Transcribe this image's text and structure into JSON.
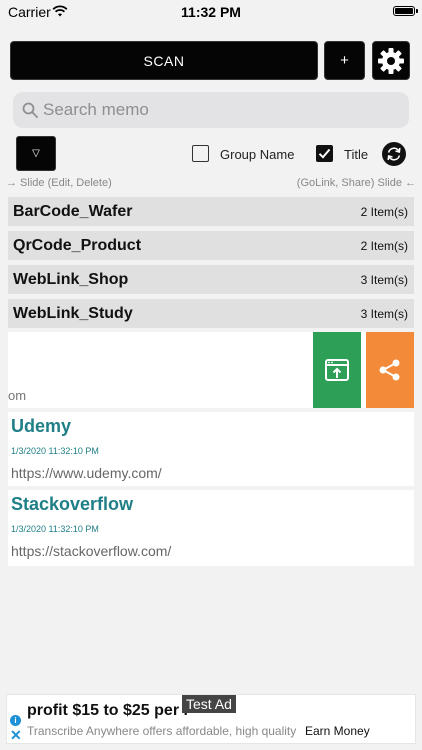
{
  "status_bar": {
    "carrier": "Carrier",
    "time": "11:32 PM"
  },
  "toolbar": {
    "scan_label": "SCAN",
    "add_label": "+"
  },
  "search": {
    "placeholder": "Search memo"
  },
  "filters": {
    "dropdown_label": "▽",
    "group_name_label": "Group Name",
    "group_name_checked": false,
    "title_label": "Title",
    "title_checked": true
  },
  "hints": {
    "left": "→ Slide (Edit, Delete)",
    "right": "(GoLink, Share) Slide ←"
  },
  "groups": [
    {
      "name": "BarCode_Wafer",
      "count": "2 Item(s)"
    },
    {
      "name": "QrCode_Product",
      "count": "2 Item(s)"
    },
    {
      "name": "WebLink_Shop",
      "count": "3 Item(s)"
    },
    {
      "name": "WebLink_Study",
      "count": "3 Item(s)"
    }
  ],
  "swiped_card": {
    "url_fragment": "om"
  },
  "memos": [
    {
      "title": "Udemy",
      "date": "1/3/2020 11:32:10 PM",
      "url": "https://www.udemy.com/"
    },
    {
      "title": "Stackoverflow",
      "date": "1/3/2020 11:32:10 PM",
      "url": "https://stackoverflow.com/"
    }
  ],
  "ad": {
    "headline": "profit $15 to $25 per h",
    "test_label": "Test Ad",
    "subtext": "Transcribe Anywhere offers affordable, high quality",
    "cta": "Earn Money"
  },
  "colors": {
    "memo_title": "#1f7f86",
    "golink_action": "#2e9f57",
    "share_action": "#f28a3a"
  }
}
